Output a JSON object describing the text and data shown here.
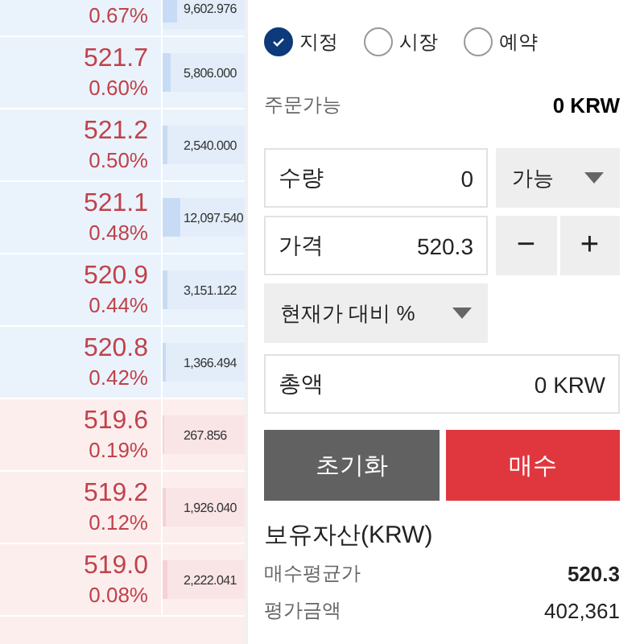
{
  "orderbook": [
    {
      "kind": "ask",
      "change": "0.67%",
      "volume": "9,602.976",
      "level": 0.17
    },
    {
      "kind": "ask",
      "price": "521.7",
      "change": "0.60%",
      "volume": "5,806.000",
      "level": 0.1
    },
    {
      "kind": "ask",
      "price": "521.2",
      "change": "0.50%",
      "volume": "2,540.000",
      "level": 0.05
    },
    {
      "kind": "ask",
      "price": "521.1",
      "change": "0.48%",
      "volume": "12,097.540",
      "level": 0.21
    },
    {
      "kind": "ask",
      "price": "520.9",
      "change": "0.44%",
      "volume": "3,151.122",
      "level": 0.06
    },
    {
      "kind": "ask",
      "price": "520.8",
      "change": "0.42%",
      "volume": "1,366.494",
      "level": 0.03
    },
    {
      "kind": "bid",
      "price": "519.6",
      "change": "0.19%",
      "volume": "267.856",
      "level": 0.01
    },
    {
      "kind": "bid",
      "price": "519.2",
      "change": "0.12%",
      "volume": "1,926.040",
      "level": 0.04
    },
    {
      "kind": "bid",
      "price": "519.0",
      "change": "0.08%",
      "volume": "2,222.041",
      "level": 0.05
    }
  ],
  "order_types": [
    {
      "label": "지정",
      "selected": true
    },
    {
      "label": "시장",
      "selected": false
    },
    {
      "label": "예약",
      "selected": false
    }
  ],
  "available": {
    "label": "주문가능",
    "value": "0 KRW"
  },
  "quantity": {
    "label": "수량",
    "value": "0",
    "mode": "가능"
  },
  "price": {
    "label": "가격",
    "value": "520.3",
    "minus": "−",
    "plus": "+"
  },
  "price_mode": "현재가 대비 %",
  "total": {
    "label": "총액",
    "value": "0 KRW"
  },
  "buttons": {
    "reset": "초기화",
    "buy": "매수"
  },
  "holdings": {
    "title": "보유자산(KRW)",
    "rows": [
      {
        "label": "매수평균가",
        "value": "520.3",
        "bold": true
      },
      {
        "label": "평가금액",
        "value": "402,361",
        "bold": false
      }
    ]
  }
}
